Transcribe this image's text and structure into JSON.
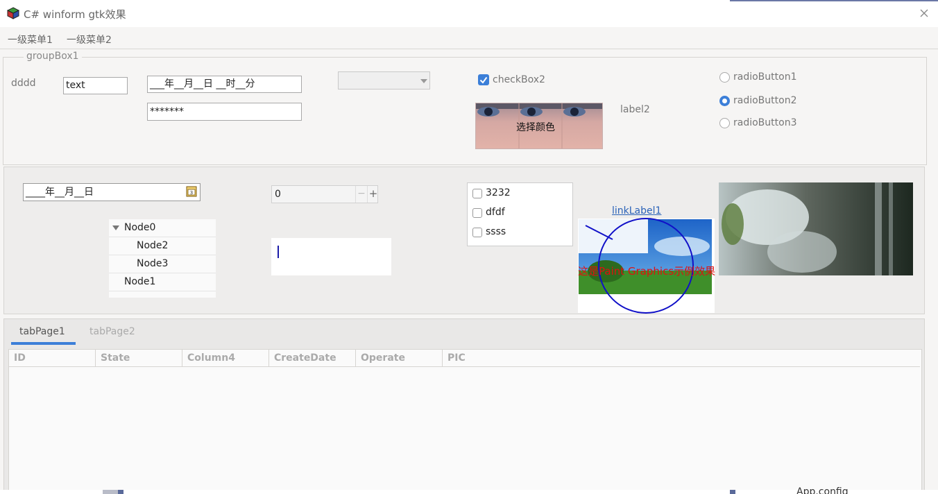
{
  "window": {
    "title": "C# winform gtk效果",
    "close_icon": "close-icon"
  },
  "menu": {
    "items": [
      "一级菜单1",
      "一级菜单2"
    ]
  },
  "groupbox": {
    "title": "groupBox1",
    "label_dddd": "dddd",
    "text_input": "text",
    "datetime_mask": "___年__月__日 __时__分",
    "password": "*******",
    "combo_value": "",
    "checkbox2": {
      "label": "checkBox2",
      "checked": true
    },
    "color_button": "选择颜色",
    "label2": "label2",
    "radios": [
      {
        "label": "radioButton1",
        "checked": false
      },
      {
        "label": "radioButton2",
        "checked": true
      },
      {
        "label": "radioButton3",
        "checked": false
      }
    ]
  },
  "panel2": {
    "date_mask": "____年__月__日",
    "spin_value": "0",
    "spin_minus": "−",
    "spin_plus": "+",
    "tree": [
      {
        "label": "Node0",
        "expanded": true
      },
      {
        "label": "Node2"
      },
      {
        "label": "Node3"
      },
      {
        "label": "Node1"
      }
    ],
    "checklist": [
      {
        "label": "3232",
        "checked": false
      },
      {
        "label": "dfdf",
        "checked": false
      },
      {
        "label": "ssss",
        "checked": false
      }
    ],
    "link_label": "linkLabel1",
    "paint_text": "这是Paint Graphics示例效果"
  },
  "tabs": {
    "items": [
      "tabPage1",
      "tabPage2"
    ],
    "active": 0
  },
  "grid": {
    "columns": [
      "ID",
      "State",
      "Column4",
      "CreateDate",
      "Operate",
      "PIC"
    ]
  },
  "taskbar_fragment": "App.config",
  "colors": {
    "accent": "#3c7fd8",
    "link": "#2a62b8",
    "paint_red": "#e01010",
    "paint_blue": "#1010c8"
  }
}
